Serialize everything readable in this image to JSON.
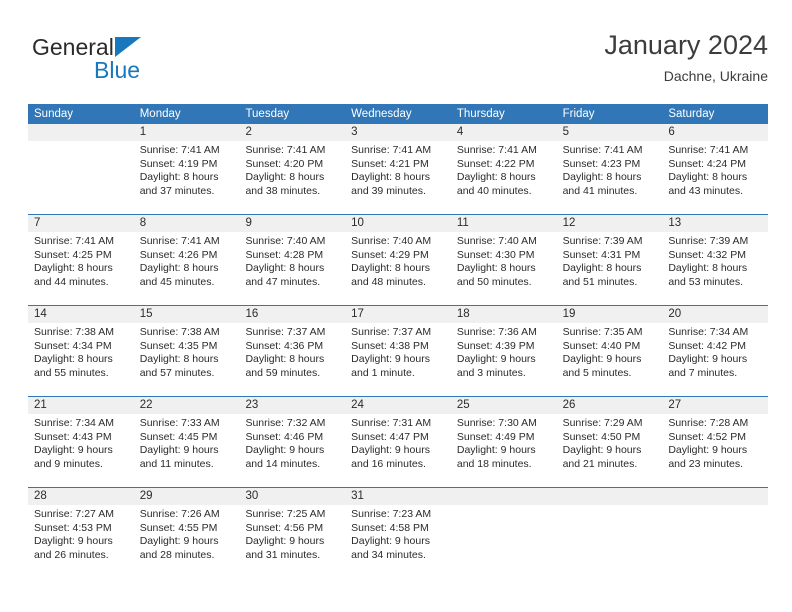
{
  "brand": {
    "name_dark": "General",
    "name_blue": "Blue",
    "triangle_color": "#1878be",
    "logo_icon": "blue-triangle-icon"
  },
  "header": {
    "title": "January 2024",
    "location": "Dachne, Ukraine"
  },
  "theme": {
    "header_blue": "#3176B6",
    "date_band_gray": "#F0F0F0",
    "text_color": "#2b2b2b",
    "brand_blue": "#1878be"
  },
  "calendar": {
    "weekday_headers": [
      "Sunday",
      "Monday",
      "Tuesday",
      "Wednesday",
      "Thursday",
      "Friday",
      "Saturday"
    ],
    "weeks": [
      [
        {
          "day": "",
          "lines": []
        },
        {
          "day": "1",
          "lines": [
            "Sunrise: 7:41 AM",
            "Sunset: 4:19 PM",
            "Daylight: 8 hours",
            "and 37 minutes."
          ]
        },
        {
          "day": "2",
          "lines": [
            "Sunrise: 7:41 AM",
            "Sunset: 4:20 PM",
            "Daylight: 8 hours",
            "and 38 minutes."
          ]
        },
        {
          "day": "3",
          "lines": [
            "Sunrise: 7:41 AM",
            "Sunset: 4:21 PM",
            "Daylight: 8 hours",
            "and 39 minutes."
          ]
        },
        {
          "day": "4",
          "lines": [
            "Sunrise: 7:41 AM",
            "Sunset: 4:22 PM",
            "Daylight: 8 hours",
            "and 40 minutes."
          ]
        },
        {
          "day": "5",
          "lines": [
            "Sunrise: 7:41 AM",
            "Sunset: 4:23 PM",
            "Daylight: 8 hours",
            "and 41 minutes."
          ]
        },
        {
          "day": "6",
          "lines": [
            "Sunrise: 7:41 AM",
            "Sunset: 4:24 PM",
            "Daylight: 8 hours",
            "and 43 minutes."
          ]
        }
      ],
      [
        {
          "day": "7",
          "lines": [
            "Sunrise: 7:41 AM",
            "Sunset: 4:25 PM",
            "Daylight: 8 hours",
            "and 44 minutes."
          ]
        },
        {
          "day": "8",
          "lines": [
            "Sunrise: 7:41 AM",
            "Sunset: 4:26 PM",
            "Daylight: 8 hours",
            "and 45 minutes."
          ]
        },
        {
          "day": "9",
          "lines": [
            "Sunrise: 7:40 AM",
            "Sunset: 4:28 PM",
            "Daylight: 8 hours",
            "and 47 minutes."
          ]
        },
        {
          "day": "10",
          "lines": [
            "Sunrise: 7:40 AM",
            "Sunset: 4:29 PM",
            "Daylight: 8 hours",
            "and 48 minutes."
          ]
        },
        {
          "day": "11",
          "lines": [
            "Sunrise: 7:40 AM",
            "Sunset: 4:30 PM",
            "Daylight: 8 hours",
            "and 50 minutes."
          ]
        },
        {
          "day": "12",
          "lines": [
            "Sunrise: 7:39 AM",
            "Sunset: 4:31 PM",
            "Daylight: 8 hours",
            "and 51 minutes."
          ]
        },
        {
          "day": "13",
          "lines": [
            "Sunrise: 7:39 AM",
            "Sunset: 4:32 PM",
            "Daylight: 8 hours",
            "and 53 minutes."
          ]
        }
      ],
      [
        {
          "day": "14",
          "lines": [
            "Sunrise: 7:38 AM",
            "Sunset: 4:34 PM",
            "Daylight: 8 hours",
            "and 55 minutes."
          ]
        },
        {
          "day": "15",
          "lines": [
            "Sunrise: 7:38 AM",
            "Sunset: 4:35 PM",
            "Daylight: 8 hours",
            "and 57 minutes."
          ]
        },
        {
          "day": "16",
          "lines": [
            "Sunrise: 7:37 AM",
            "Sunset: 4:36 PM",
            "Daylight: 8 hours",
            "and 59 minutes."
          ]
        },
        {
          "day": "17",
          "lines": [
            "Sunrise: 7:37 AM",
            "Sunset: 4:38 PM",
            "Daylight: 9 hours",
            "and 1 minute."
          ]
        },
        {
          "day": "18",
          "lines": [
            "Sunrise: 7:36 AM",
            "Sunset: 4:39 PM",
            "Daylight: 9 hours",
            "and 3 minutes."
          ]
        },
        {
          "day": "19",
          "lines": [
            "Sunrise: 7:35 AM",
            "Sunset: 4:40 PM",
            "Daylight: 9 hours",
            "and 5 minutes."
          ]
        },
        {
          "day": "20",
          "lines": [
            "Sunrise: 7:34 AM",
            "Sunset: 4:42 PM",
            "Daylight: 9 hours",
            "and 7 minutes."
          ]
        }
      ],
      [
        {
          "day": "21",
          "lines": [
            "Sunrise: 7:34 AM",
            "Sunset: 4:43 PM",
            "Daylight: 9 hours",
            "and 9 minutes."
          ]
        },
        {
          "day": "22",
          "lines": [
            "Sunrise: 7:33 AM",
            "Sunset: 4:45 PM",
            "Daylight: 9 hours",
            "and 11 minutes."
          ]
        },
        {
          "day": "23",
          "lines": [
            "Sunrise: 7:32 AM",
            "Sunset: 4:46 PM",
            "Daylight: 9 hours",
            "and 14 minutes."
          ]
        },
        {
          "day": "24",
          "lines": [
            "Sunrise: 7:31 AM",
            "Sunset: 4:47 PM",
            "Daylight: 9 hours",
            "and 16 minutes."
          ]
        },
        {
          "day": "25",
          "lines": [
            "Sunrise: 7:30 AM",
            "Sunset: 4:49 PM",
            "Daylight: 9 hours",
            "and 18 minutes."
          ]
        },
        {
          "day": "26",
          "lines": [
            "Sunrise: 7:29 AM",
            "Sunset: 4:50 PM",
            "Daylight: 9 hours",
            "and 21 minutes."
          ]
        },
        {
          "day": "27",
          "lines": [
            "Sunrise: 7:28 AM",
            "Sunset: 4:52 PM",
            "Daylight: 9 hours",
            "and 23 minutes."
          ]
        }
      ],
      [
        {
          "day": "28",
          "lines": [
            "Sunrise: 7:27 AM",
            "Sunset: 4:53 PM",
            "Daylight: 9 hours",
            "and 26 minutes."
          ]
        },
        {
          "day": "29",
          "lines": [
            "Sunrise: 7:26 AM",
            "Sunset: 4:55 PM",
            "Daylight: 9 hours",
            "and 28 minutes."
          ]
        },
        {
          "day": "30",
          "lines": [
            "Sunrise: 7:25 AM",
            "Sunset: 4:56 PM",
            "Daylight: 9 hours",
            "and 31 minutes."
          ]
        },
        {
          "day": "31",
          "lines": [
            "Sunrise: 7:23 AM",
            "Sunset: 4:58 PM",
            "Daylight: 9 hours",
            "and 34 minutes."
          ]
        },
        {
          "day": "",
          "lines": []
        },
        {
          "day": "",
          "lines": []
        },
        {
          "day": "",
          "lines": []
        }
      ]
    ]
  }
}
